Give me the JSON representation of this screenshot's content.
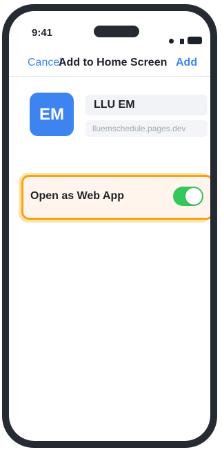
{
  "status_bar": {
    "time": "9:41"
  },
  "nav": {
    "cancel_label": "Cancel",
    "title": "Add to Home Screen",
    "add_label": "Add"
  },
  "app": {
    "icon_text": "EM",
    "name_value": "LLU EM",
    "url_text": "lluemschedule.pages.dev"
  },
  "option": {
    "label": "Open as Web App",
    "enabled": true
  },
  "colors": {
    "accent": "#3d86ee",
    "icon_bg": "#3e84f0",
    "toggle_on": "#33c75c",
    "highlight_border": "#f5a21c",
    "highlight_glow": "#fbe4a6",
    "phone_frame": "#252a33"
  }
}
